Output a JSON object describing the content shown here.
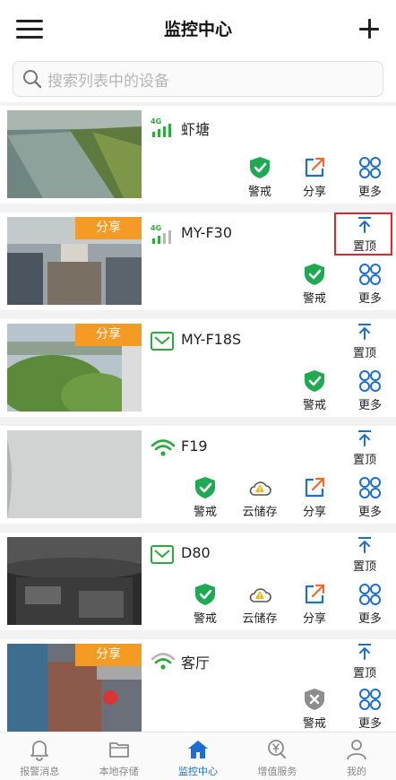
{
  "header": {
    "title": "监控中心"
  },
  "search": {
    "placeholder": "搜索列表中的设备"
  },
  "devices": [
    {
      "name": "虾塘",
      "network": "4G",
      "shared": false,
      "actions": [
        "警戒",
        "分享",
        "更多"
      ]
    },
    {
      "name": "MY-F30",
      "network": "4G",
      "shared": true,
      "share_label": "分享",
      "pin_label": "置顶",
      "actions": [
        "警戒",
        "更多"
      ]
    },
    {
      "name": "MY-F18S",
      "network": "ethernet",
      "shared": true,
      "share_label": "分享",
      "pin_label": "置顶",
      "actions": [
        "警戒",
        "更多"
      ]
    },
    {
      "name": "F19",
      "network": "wifi",
      "shared": false,
      "pin_label": "置顶",
      "actions": [
        "警戒",
        "云储存",
        "分享",
        "更多"
      ]
    },
    {
      "name": "D80",
      "network": "ethernet",
      "shared": false,
      "pin_label": "置顶",
      "actions": [
        "警戒",
        "云储存",
        "分享",
        "更多"
      ]
    },
    {
      "name": "客厅",
      "network": "wifi",
      "shared": true,
      "share_label": "分享",
      "pin_label": "置顶",
      "actions": [
        "警戒",
        "更多"
      ]
    }
  ],
  "tabs": [
    {
      "label": "报警消息",
      "icon": "bell-icon"
    },
    {
      "label": "本地存储",
      "icon": "folder-icon"
    },
    {
      "label": "监控中心",
      "icon": "home-icon",
      "active": true
    },
    {
      "label": "增值服务",
      "icon": "yuan-badge-icon"
    },
    {
      "label": "我的",
      "icon": "user-icon"
    }
  ],
  "colors": {
    "accent": "#1c6fd1",
    "shield_green": "#1ea952",
    "share_orange": "#f49b25",
    "highlight_red": "#e0252b"
  }
}
